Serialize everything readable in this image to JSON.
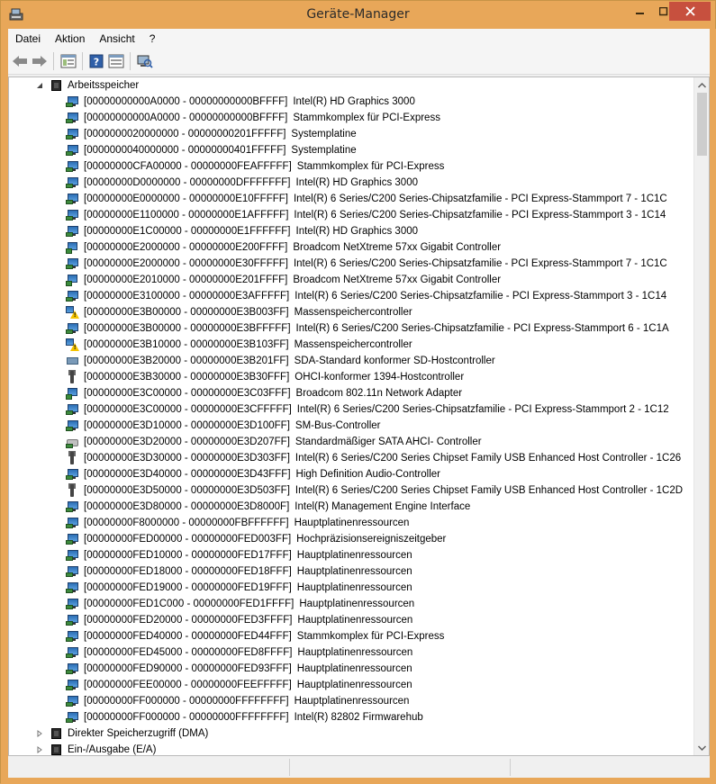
{
  "window": {
    "title": "Geräte-Manager"
  },
  "menu": [
    "Datei",
    "Aktion",
    "Ansicht",
    "?"
  ],
  "toolbar": [
    "back-icon",
    "forward-icon",
    "properties-view-icon",
    "help-icon",
    "show-hide-icon",
    "scan-hardware-icon"
  ],
  "tree": {
    "root": {
      "label": "Arbeitsspeicher",
      "expanded": true
    },
    "items": [
      {
        "range": "[00000000000A0000 - 00000000000BFFFF]",
        "label": "Intel(R) HD Graphics 3000",
        "icon": "display-adapter-icon"
      },
      {
        "range": "[00000000000A0000 - 00000000000BFFFF]",
        "label": "Stammkomplex für PCI-Express",
        "icon": "system-device-icon"
      },
      {
        "range": "[0000000020000000 - 00000000201FFFFF]",
        "label": "Systemplatine",
        "icon": "system-device-icon"
      },
      {
        "range": "[0000000040000000 - 00000000401FFFFF]",
        "label": "Systemplatine",
        "icon": "system-device-icon"
      },
      {
        "range": "[00000000CFA00000 - 00000000FEAFFFFF]",
        "label": "Stammkomplex für PCI-Express",
        "icon": "system-device-icon"
      },
      {
        "range": "[00000000D0000000 - 00000000DFFFFFFF]",
        "label": "Intel(R) HD Graphics 3000",
        "icon": "display-adapter-icon"
      },
      {
        "range": "[00000000E0000000 - 00000000E10FFFFF]",
        "label": "Intel(R) 6 Series/C200 Series-Chipsatzfamilie - PCI Express-Stammport 7 - 1C1C",
        "icon": "system-device-icon"
      },
      {
        "range": "[00000000E1100000 - 00000000E1AFFFFF]",
        "label": "Intel(R) 6 Series/C200 Series-Chipsatzfamilie - PCI Express-Stammport 3 - 1C14",
        "icon": "system-device-icon"
      },
      {
        "range": "[00000000E1C00000 - 00000000E1FFFFFF]",
        "label": "Intel(R) HD Graphics 3000",
        "icon": "display-adapter-icon"
      },
      {
        "range": "[00000000E2000000 - 00000000E200FFFF]",
        "label": "Broadcom NetXtreme 57xx Gigabit Controller",
        "icon": "network-adapter-icon"
      },
      {
        "range": "[00000000E2000000 - 00000000E30FFFFF]",
        "label": "Intel(R) 6 Series/C200 Series-Chipsatzfamilie - PCI Express-Stammport 7 - 1C1C",
        "icon": "system-device-icon"
      },
      {
        "range": "[00000000E2010000 - 00000000E201FFFF]",
        "label": "Broadcom NetXtreme 57xx Gigabit Controller",
        "icon": "network-adapter-icon"
      },
      {
        "range": "[00000000E3100000 - 00000000E3AFFFFF]",
        "label": "Intel(R) 6 Series/C200 Series-Chipsatzfamilie - PCI Express-Stammport 3 - 1C14",
        "icon": "system-device-icon"
      },
      {
        "range": "[00000000E3B00000 - 00000000E3B003FF]",
        "label": "Massenspeichercontroller",
        "icon": "warning-device-icon"
      },
      {
        "range": "[00000000E3B00000 - 00000000E3BFFFFF]",
        "label": "Intel(R) 6 Series/C200 Series-Chipsatzfamilie - PCI Express-Stammport 6 - 1C1A",
        "icon": "system-device-icon"
      },
      {
        "range": "[00000000E3B10000 - 00000000E3B103FF]",
        "label": "Massenspeichercontroller",
        "icon": "warning-device-icon"
      },
      {
        "range": "[00000000E3B20000 - 00000000E3B201FF]",
        "label": "SDA-Standard konformer SD-Hostcontroller",
        "icon": "sd-host-icon"
      },
      {
        "range": "[00000000E3B30000 - 00000000E3B30FFF]",
        "label": "OHCI-konformer 1394-Hostcontroller",
        "icon": "usb-controller-icon"
      },
      {
        "range": "[00000000E3C00000 - 00000000E3C03FFF]",
        "label": "Broadcom 802.11n Network Adapter",
        "icon": "network-adapter-icon"
      },
      {
        "range": "[00000000E3C00000 - 00000000E3CFFFFF]",
        "label": "Intel(R) 6 Series/C200 Series-Chipsatzfamilie - PCI Express-Stammport 2 - 1C12",
        "icon": "system-device-icon"
      },
      {
        "range": "[00000000E3D10000 - 00000000E3D100FF]",
        "label": "SM-Bus-Controller",
        "icon": "system-device-icon"
      },
      {
        "range": "[00000000E3D20000 - 00000000E3D207FF]",
        "label": "Standardmäßiger SATA AHCI- Controller",
        "icon": "disk-controller-icon"
      },
      {
        "range": "[00000000E3D30000 - 00000000E3D303FF]",
        "label": "Intel(R) 6 Series/C200 Series Chipset Family USB Enhanced Host Controller - 1C26",
        "icon": "usb-controller-icon"
      },
      {
        "range": "[00000000E3D40000 - 00000000E3D43FFF]",
        "label": "High Definition Audio-Controller",
        "icon": "system-device-icon"
      },
      {
        "range": "[00000000E3D50000 - 00000000E3D503FF]",
        "label": "Intel(R) 6 Series/C200 Series Chipset Family USB Enhanced Host Controller - 1C2D",
        "icon": "usb-controller-icon"
      },
      {
        "range": "[00000000E3D80000 - 00000000E3D8000F]",
        "label": "Intel(R) Management Engine Interface",
        "icon": "system-device-icon"
      },
      {
        "range": "[00000000F8000000 - 00000000FBFFFFFF]",
        "label": "Hauptplatinenressourcen",
        "icon": "system-device-icon"
      },
      {
        "range": "[00000000FED00000 - 00000000FED003FF]",
        "label": "Hochpräzisionsereigniszeitgeber",
        "icon": "system-device-icon"
      },
      {
        "range": "[00000000FED10000 - 00000000FED17FFF]",
        "label": "Hauptplatinenressourcen",
        "icon": "system-device-icon"
      },
      {
        "range": "[00000000FED18000 - 00000000FED18FFF]",
        "label": "Hauptplatinenressourcen",
        "icon": "system-device-icon"
      },
      {
        "range": "[00000000FED19000 - 00000000FED19FFF]",
        "label": "Hauptplatinenressourcen",
        "icon": "system-device-icon"
      },
      {
        "range": "[00000000FED1C000 - 00000000FED1FFFF]",
        "label": "Hauptplatinenressourcen",
        "icon": "system-device-icon"
      },
      {
        "range": "[00000000FED20000 - 00000000FED3FFFF]",
        "label": "Hauptplatinenressourcen",
        "icon": "system-device-icon"
      },
      {
        "range": "[00000000FED40000 - 00000000FED44FFF]",
        "label": "Stammkomplex für PCI-Express",
        "icon": "system-device-icon"
      },
      {
        "range": "[00000000FED45000 - 00000000FED8FFFF]",
        "label": "Hauptplatinenressourcen",
        "icon": "system-device-icon"
      },
      {
        "range": "[00000000FED90000 - 00000000FED93FFF]",
        "label": "Hauptplatinenressourcen",
        "icon": "system-device-icon"
      },
      {
        "range": "[00000000FEE00000 - 00000000FEEFFFFF]",
        "label": "Hauptplatinenressourcen",
        "icon": "system-device-icon"
      },
      {
        "range": "[00000000FF000000 - 00000000FFFFFFFF]",
        "label": "Hauptplatinenressourcen",
        "icon": "system-device-icon"
      },
      {
        "range": "[00000000FF000000 - 00000000FFFFFFFF]",
        "label": "Intel(R) 82802 Firmwarehub",
        "icon": "system-device-icon"
      }
    ],
    "collapsed_roots": [
      {
        "label": "Direkter Speicherzugriff (DMA)"
      },
      {
        "label": "Ein-/Ausgabe (E/A)"
      }
    ]
  }
}
